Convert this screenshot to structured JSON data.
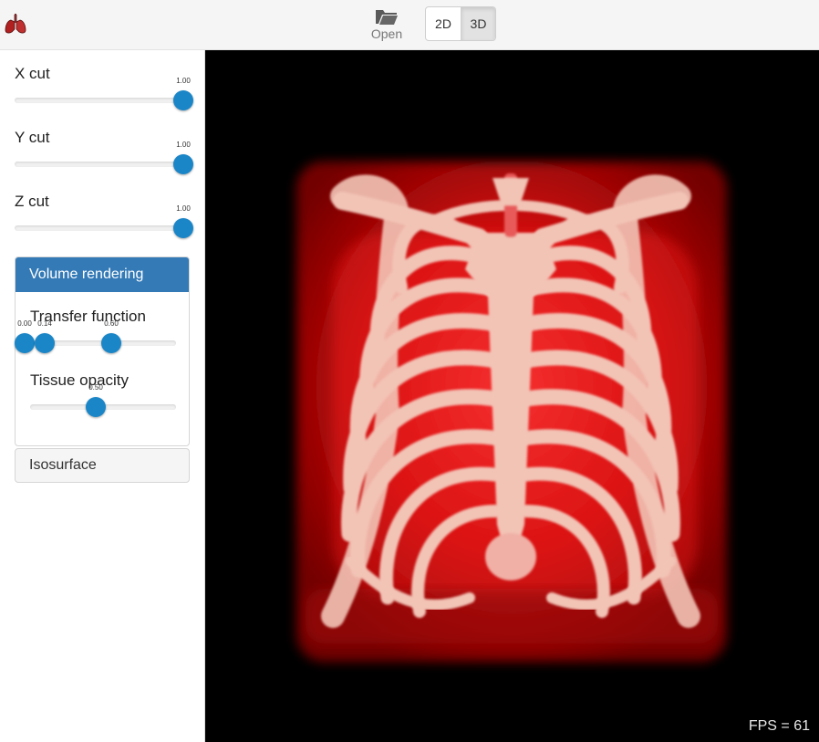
{
  "toolbar": {
    "logo_icon": "lungs-icon",
    "open_icon": "folder-open-icon",
    "open_label": "Open",
    "view_modes": [
      {
        "label": "2D",
        "active": false
      },
      {
        "label": "3D",
        "active": true
      }
    ]
  },
  "sidebar": {
    "x_cut": {
      "label": "X cut",
      "value": "1.00"
    },
    "y_cut": {
      "label": "Y cut",
      "value": "1.00"
    },
    "z_cut": {
      "label": "Z cut",
      "value": "1.00"
    },
    "volume_panel": {
      "title": "Volume rendering",
      "transfer_function": {
        "label": "Transfer function",
        "values": [
          "0.00",
          "0.14",
          "0.60"
        ]
      },
      "tissue_opacity": {
        "label": "Tissue opacity",
        "value": "0.50"
      }
    },
    "isosurface_panel": {
      "title": "Isosurface"
    }
  },
  "viewport": {
    "fps_text": "FPS = 61",
    "colors": {
      "background": "#000000",
      "tissue": "#e01010",
      "bone": "#f2c7b8"
    }
  }
}
